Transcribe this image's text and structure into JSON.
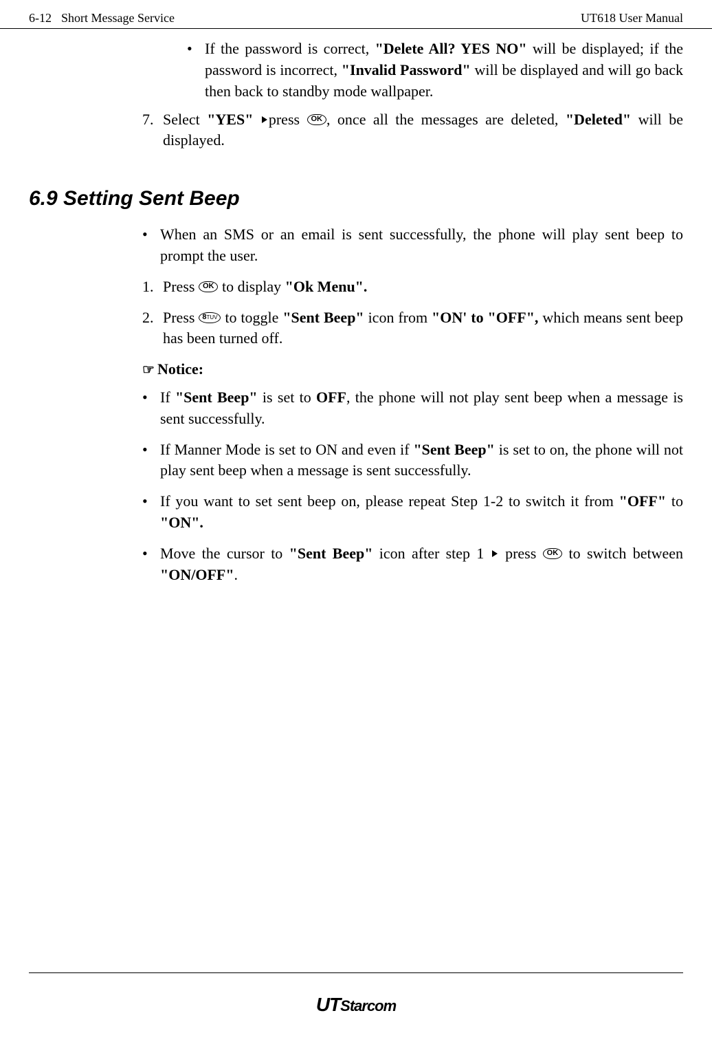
{
  "header": {
    "page_num": "6-12",
    "section_name": "Short Message Service",
    "manual_name": "UT618 User Manual"
  },
  "bullet1": {
    "prefix": "If the password is correct, ",
    "bold1": "\"Delete All? YES NO\"",
    "mid1": " will be displayed; if the password is incorrect, ",
    "bold2": "\"Invalid Password\"",
    "suffix": " will be displayed and will go back then back to standby mode wallpaper."
  },
  "step7": {
    "num": "7.",
    "t1": "Select ",
    "b1": "\"YES\"",
    "t2": "press ",
    "t3": ", once all the messages are deleted, ",
    "b2": "\"Deleted\"",
    "t4": " will be displayed."
  },
  "section_title": "6.9   Setting Sent Beep",
  "bullet2": "When an SMS or an email is sent successfully, the phone will play sent beep to prompt the user.",
  "step1": {
    "num": "1.",
    "t1": "Press ",
    "t2": " to display ",
    "b1": "\"Ok Menu\"."
  },
  "step2": {
    "num": "2.",
    "t1": "Press ",
    "t2": " to toggle ",
    "b1": "\"Sent Beep\"",
    "t3": " icon from ",
    "b2": "\"ON' to \"OFF\",",
    "t4": " which means sent beep has been turned off."
  },
  "notice_label": "Notice:",
  "bullet3": {
    "t1": "If ",
    "b1": "\"Sent Beep\"",
    "t2": " is set to ",
    "b2": "OFF",
    "t3": ", the phone will not play sent beep when a message is sent successfully."
  },
  "bullet4": {
    "t1": "If Manner Mode is set to ON and even if ",
    "b1": "\"Sent Beep\"",
    "t2": " is set to on, the phone will not play sent beep when a message is sent successfully."
  },
  "bullet5": {
    "t1": "If you want to set sent beep on, please repeat Step 1-2 to switch it from ",
    "b1": "\"OFF\"",
    "t2": " to ",
    "b2": "\"ON\"."
  },
  "bullet6": {
    "t1": "Move the cursor to ",
    "b1": "\"Sent Beep\"",
    "t2": " icon after step 1 ",
    "t3": " press ",
    "t4": " to switch between ",
    "b2": "\"ON/OFF\"",
    "t5": "."
  },
  "buttons": {
    "ok": "OK",
    "key8": "8",
    "key8suffix": "TUV"
  },
  "logo": {
    "ut": "UT",
    "starcom": "Starcom"
  }
}
